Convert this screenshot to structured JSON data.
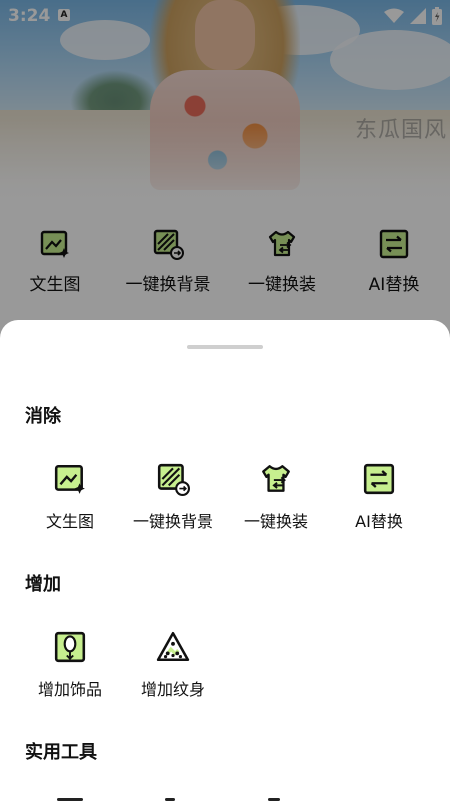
{
  "status_bar": {
    "time": "3:24",
    "notification_badge": "A",
    "icons": [
      "wifi-icon",
      "signal-icon",
      "battery-icon"
    ]
  },
  "background": {
    "watermark": "东瓜国风"
  },
  "upper_tools": [
    {
      "label": "文生图",
      "icon": "text-to-image-icon"
    },
    {
      "label": "一键换背景",
      "icon": "swap-background-icon"
    },
    {
      "label": "一键换装",
      "icon": "swap-outfit-icon"
    },
    {
      "label": "AI替换",
      "icon": "ai-replace-icon"
    }
  ],
  "sheet": {
    "sections": [
      {
        "title": "消除",
        "items": [
          {
            "label": "文生图",
            "icon": "text-to-image-icon"
          },
          {
            "label": "一键换背景",
            "icon": "swap-background-icon"
          },
          {
            "label": "一键换装",
            "icon": "swap-outfit-icon"
          },
          {
            "label": "AI替换",
            "icon": "ai-replace-icon"
          }
        ]
      },
      {
        "title": "增加",
        "items": [
          {
            "label": "增加饰品",
            "icon": "accessory-icon"
          },
          {
            "label": "增加纹身",
            "icon": "tattoo-icon"
          }
        ]
      },
      {
        "title": "实用工具",
        "items": []
      }
    ]
  },
  "colors": {
    "accent_green": "#c7ef8f",
    "text": "#111111",
    "scrim": "rgba(0,0,0,0.40)"
  }
}
